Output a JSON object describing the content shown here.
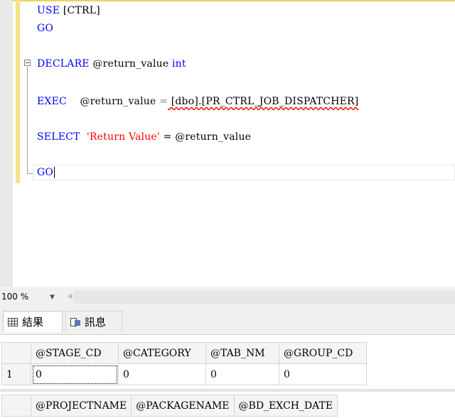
{
  "editor": {
    "lines": {
      "l1": {
        "kw": "USE",
        "rest": " [CTRL]"
      },
      "l2": {
        "kw": "GO"
      },
      "l3": {
        "kw1": "DECLARE",
        "var": " @return_value ",
        "kw2": "int"
      },
      "l4": {
        "kw": "EXEC",
        "var": "    @return_value ",
        "eq": "=",
        "obj": " [dbo].[PR_CTRL_JOB_DISPATCHER]"
      },
      "l5": {
        "kw": "SELECT",
        "str": "  'Return Value'",
        "rest": " = @return_value"
      },
      "l6": {
        "kw": "GO"
      }
    }
  },
  "zoom": {
    "value": "100 %"
  },
  "tabs": {
    "results": "結果",
    "messages": "訊息"
  },
  "grid1": {
    "headers": [
      "@STAGE_CD",
      "@CATEGORY",
      "@TAB_NM",
      "@GROUP_CD"
    ],
    "row_number": "1",
    "values": [
      "0",
      "0",
      "0",
      "0"
    ]
  },
  "grid2": {
    "headers": [
      "@PROJECTNAME",
      "@PACKAGENAME",
      "@BD_EXCH_DATE"
    ]
  }
}
